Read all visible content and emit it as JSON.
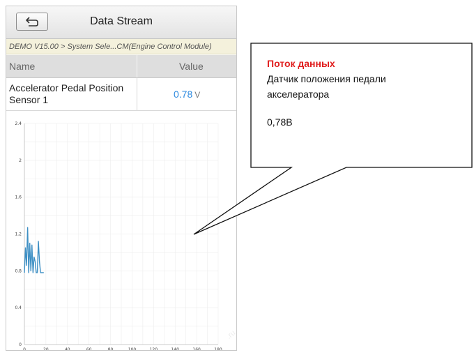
{
  "header": {
    "title": "Data Stream",
    "back_icon": "back-arrow-icon"
  },
  "breadcrumb": "DEMO V15.00 > System Sele...CM(Engine Control Module)",
  "table": {
    "columns": [
      "Name",
      "Value"
    ],
    "rows": [
      {
        "name": "Accelerator Pedal Position Sensor 1",
        "value": "0.78",
        "unit": "V"
      }
    ]
  },
  "chart_data": {
    "type": "line",
    "title": "",
    "xlabel": "",
    "ylabel": "",
    "xlim": [
      0,
      180
    ],
    "ylim": [
      0,
      2.4
    ],
    "x_ticks": [
      "0",
      "20",
      "40",
      "60",
      "80",
      "100",
      "120",
      "140",
      "160",
      "180"
    ],
    "y_ticks": [
      "0",
      "0.4",
      "0.8",
      "1.2",
      "1.6",
      "2",
      "2.4"
    ],
    "grid": true,
    "line_color": "#3d8fc4",
    "series": [
      {
        "x": [
          0,
          1,
          2,
          3,
          4,
          5,
          6,
          7,
          8,
          9,
          10,
          11,
          12,
          13,
          14,
          15,
          16,
          17,
          18
        ],
        "values": [
          0.78,
          1.05,
          0.86,
          1.27,
          0.78,
          1.1,
          0.8,
          1.08,
          0.78,
          0.95,
          0.9,
          0.78,
          0.78,
          1.12,
          0.9,
          0.78,
          0.78,
          0.78,
          0.78
        ]
      }
    ]
  },
  "callout": {
    "title": "Поток данных",
    "body": "Датчик положения педали акселератора",
    "value": "0,78В"
  },
  "colors": {
    "accent": "#2f8be0",
    "callout_title": "#e01d1d",
    "line": "#3d8fc4"
  }
}
